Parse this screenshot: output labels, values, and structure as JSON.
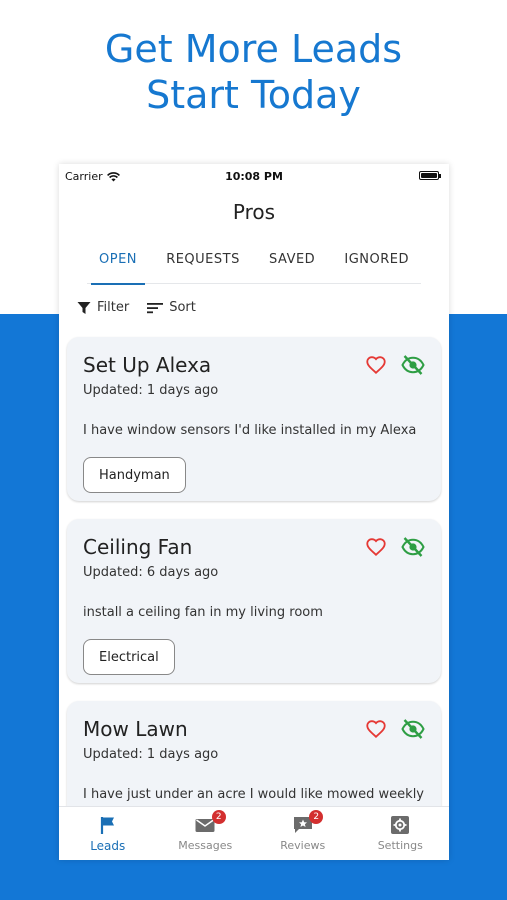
{
  "headline": {
    "line1": "Get More Leads",
    "line2": "Start Today"
  },
  "status_bar": {
    "carrier": "Carrier",
    "time": "10:08 PM"
  },
  "app": {
    "title": "Pros"
  },
  "tabs": [
    {
      "label": "OPEN",
      "active": true
    },
    {
      "label": "REQUESTS",
      "active": false
    },
    {
      "label": "SAVED",
      "active": false
    },
    {
      "label": "IGNORED",
      "active": false
    }
  ],
  "toolbar": {
    "filter_label": "Filter",
    "sort_label": "Sort"
  },
  "leads": [
    {
      "title": "Set Up Alexa",
      "updated": "Updated: 1 days ago",
      "description": "I have window sensors I'd like installed in my Alexa",
      "category": "Handyman"
    },
    {
      "title": "Ceiling Fan",
      "updated": "Updated: 6 days ago",
      "description": "install a ceiling fan in my living room",
      "category": "Electrical"
    },
    {
      "title": "Mow Lawn",
      "updated": "Updated: 1 days ago",
      "description": "I have just under an acre I would like mowed weekly",
      "category": ""
    }
  ],
  "bottom_nav": [
    {
      "label": "Leads",
      "icon": "flag-icon",
      "badge": ""
    },
    {
      "label": "Messages",
      "icon": "mail-icon",
      "badge": "2"
    },
    {
      "label": "Reviews",
      "icon": "review-icon",
      "badge": "2"
    },
    {
      "label": "Settings",
      "icon": "gear-icon",
      "badge": ""
    }
  ],
  "colors": {
    "brand_blue": "#1377d6",
    "headline_blue": "#1678d0",
    "tab_active": "#1a6fb5",
    "heart_red": "#e53935",
    "eye_green": "#2e9e44",
    "badge_red": "#d32f2f"
  }
}
